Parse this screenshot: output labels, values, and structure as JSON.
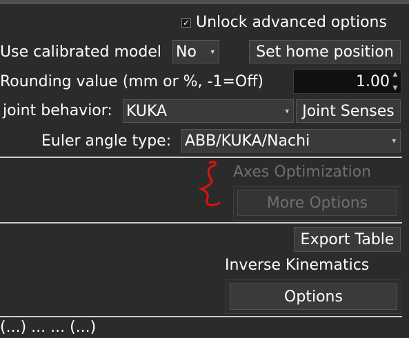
{
  "unlock_advanced": {
    "label": "Unlock advanced options",
    "checked": true
  },
  "calibrated_model": {
    "label": "Use calibrated model",
    "value": "No"
  },
  "set_home_label": "Set home position",
  "rounding": {
    "label": "Rounding value (mm or %, -1=Off)",
    "value": "1.00"
  },
  "joint_behavior": {
    "label": "joint behavior:",
    "value": "KUKA"
  },
  "joint_senses_label": "Joint Senses",
  "euler": {
    "label": "Euler angle type:",
    "value": "ABB/KUKA/Nachi"
  },
  "axes_optimization_label": "Axes Optimization",
  "more_options_label": "More Options",
  "export_table_label": "Export Table",
  "inverse_kinematics_label": "Inverse Kinematics",
  "options_label": "Options",
  "bottom_partial_text": "(...)    ...  ... (...)",
  "colors": {
    "annotation": "#e01010",
    "disabled_text": "#6f6f6f"
  }
}
